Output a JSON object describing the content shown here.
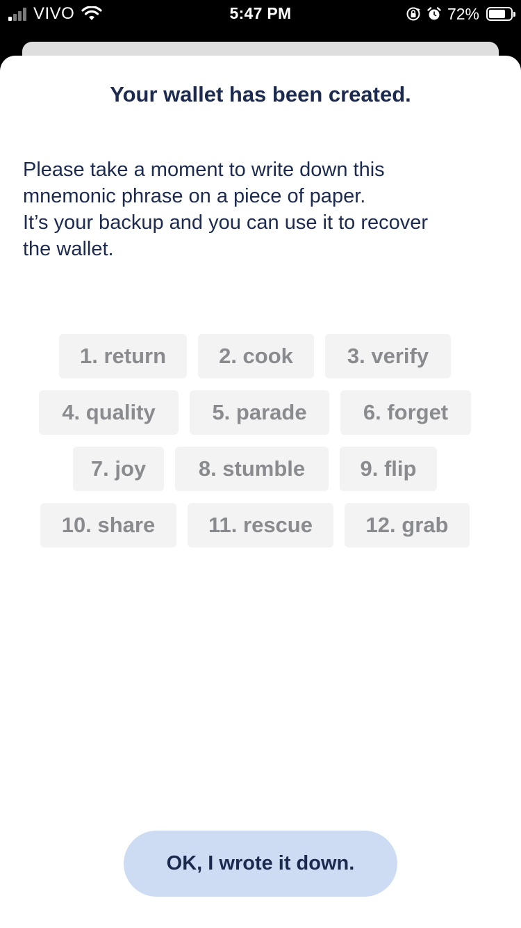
{
  "status_bar": {
    "carrier": "VIVO",
    "time": "5:47 PM",
    "battery_percent": "72%",
    "icons": [
      "signal-icon",
      "wifi-icon",
      "orientation-lock-icon",
      "alarm-icon",
      "battery-icon"
    ]
  },
  "sheet": {
    "title": "Your wallet has been created.",
    "instructions": [
      "Please take a moment to write down this",
      "mnemonic phrase on a piece of paper.",
      "It’s your backup and you can use it to recover",
      "the wallet."
    ],
    "words": [
      "1. return",
      "2. cook",
      "3. verify",
      "4. quality",
      "5. parade",
      "6. forget",
      "7. joy",
      "8. stumble",
      "9. flip",
      "10. share",
      "11. rescue",
      "12. grab"
    ],
    "confirm_button": "OK, I wrote it down."
  },
  "colors": {
    "title_text": "#1b2a4e",
    "chip_background": "#f3f3f4",
    "chip_text": "#8a8b8f",
    "button_background": "#cddcf3"
  }
}
